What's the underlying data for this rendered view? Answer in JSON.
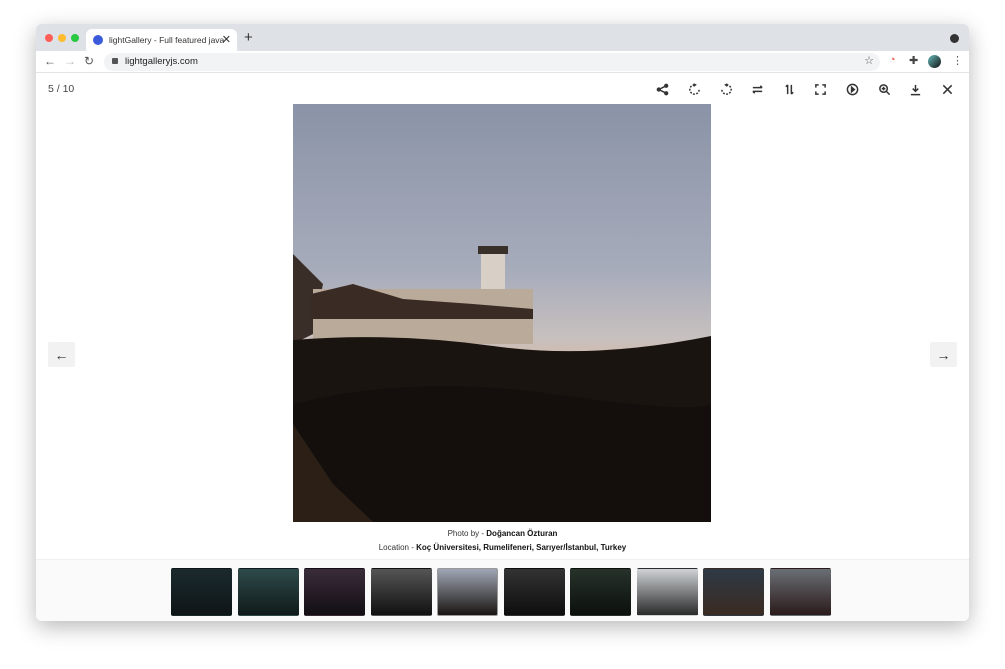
{
  "browser": {
    "tab_title": "lightGallery - Full featured javascript image & video gallery",
    "url": "lightgalleryjs.com",
    "colors": {
      "close": "#ff5f57",
      "minimize": "#febc2e",
      "maximize": "#28c840"
    }
  },
  "gallery": {
    "counter": "5 / 10",
    "current": 5,
    "total": 10,
    "toolbar": [
      "share-icon",
      "rotate-right-icon",
      "rotate-left-icon",
      "flip-horizontal-icon",
      "flip-vertical-icon",
      "fullscreen-icon",
      "play-icon",
      "zoom-in-icon",
      "download-icon",
      "close-icon"
    ],
    "caption": {
      "photo_prefix": "Photo by - ",
      "photographer": "Doğancan Özturan",
      "location_prefix": "Location - ",
      "location": "Koç Üniversitesi, Rumelifeneri, Sarıyer/İstanbul, Turkey"
    },
    "thumbnails": [
      {
        "colors": [
          "#1b2a2e",
          "#0e1517"
        ]
      },
      {
        "colors": [
          "#2e4a4a",
          "#111a1a"
        ]
      },
      {
        "colors": [
          "#3a2c3a",
          "#120e14"
        ]
      },
      {
        "colors": [
          "#555",
          "#111"
        ]
      },
      {
        "colors": [
          "#9fa6b4",
          "#1a1512"
        ]
      },
      {
        "colors": [
          "#333",
          "#0d0d0d"
        ]
      },
      {
        "colors": [
          "#26322a",
          "#0c100d"
        ]
      },
      {
        "colors": [
          "#cfd3d6",
          "#2a2a2a"
        ]
      },
      {
        "colors": [
          "#2d3a45",
          "#3b2a22"
        ]
      },
      {
        "colors": [
          "#6a6f75",
          "#2b1a1a"
        ]
      }
    ]
  }
}
